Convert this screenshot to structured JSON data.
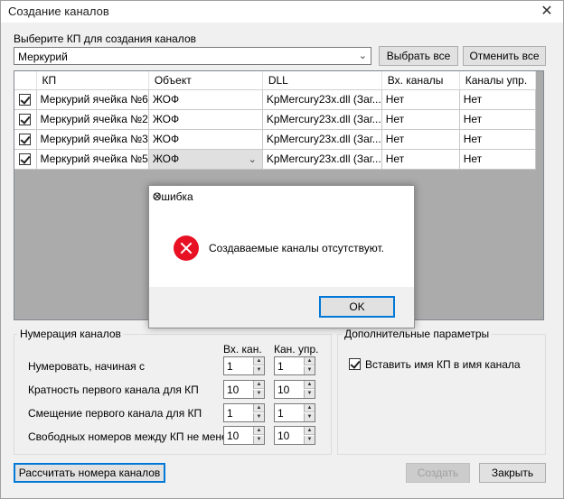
{
  "window": {
    "title": "Создание каналов",
    "close_label": "✕"
  },
  "top": {
    "choose_label": "Выберите КП для создания каналов",
    "kp_selected": "Меркурий",
    "select_all": "Выбрать все",
    "deselect_all": "Отменить все"
  },
  "grid": {
    "columns": [
      "",
      "КП",
      "Объект",
      "DLL",
      "Вх. каналы",
      "Каналы упр."
    ],
    "rows": [
      {
        "kp": "Меркурий ячейка №6",
        "object": "ЖОФ",
        "dll": "KpMercury23x.dll (Заг...",
        "in": "Нет",
        "ctrl": "Нет"
      },
      {
        "kp": "Меркурий ячейка №2",
        "object": "ЖОФ",
        "dll": "KpMercury23x.dll (Заг...",
        "in": "Нет",
        "ctrl": "Нет"
      },
      {
        "kp": "Меркурий ячейка №3",
        "object": "ЖОФ",
        "dll": "KpMercury23x.dll (Заг...",
        "in": "Нет",
        "ctrl": "Нет"
      },
      {
        "kp": "Меркурий ячейка №5",
        "object": "ЖОФ",
        "dll": "KpMercury23x.dll (Заг...",
        "in": "Нет",
        "ctrl": "Нет"
      }
    ]
  },
  "numbering": {
    "title": "Нумерация каналов",
    "col_in": "Вх. кан.",
    "col_ctrl": "Кан. упр.",
    "rows": [
      {
        "label": "Нумеровать, начиная с",
        "in": "1",
        "ctrl": "1"
      },
      {
        "label": "Кратность первого канала для КП",
        "in": "10",
        "ctrl": "10"
      },
      {
        "label": "Смещение первого канала для КП",
        "in": "1",
        "ctrl": "1"
      },
      {
        "label": "Свободных номеров между КП не менее",
        "in": "10",
        "ctrl": "10"
      }
    ]
  },
  "extra": {
    "title": "Дополнительные параметры",
    "insert_name": "Вставить имя КП в имя канала"
  },
  "bottom": {
    "calc": "Рассчитать номера каналов",
    "create": "Создать",
    "close": "Закрыть"
  },
  "dialog": {
    "title": "Ошибка",
    "message": "Создаваемые каналы отсутствуют.",
    "ok": "OK"
  },
  "icons": {
    "checkbox": "check-icon",
    "error": "error-icon",
    "dropdown": "chevron-down-icon",
    "spin_up": "spin-up-icon",
    "spin_down": "spin-down-icon"
  }
}
